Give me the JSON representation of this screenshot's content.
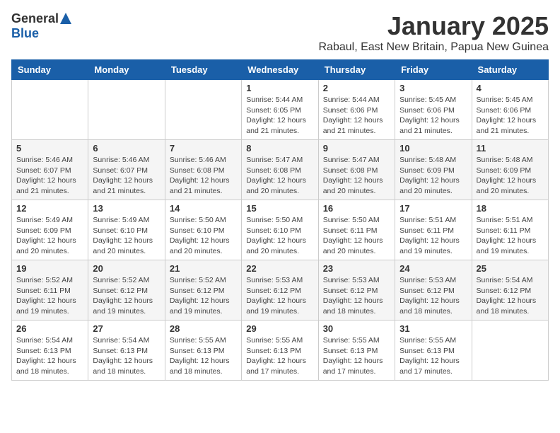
{
  "header": {
    "logo_general": "General",
    "logo_blue": "Blue",
    "month_title": "January 2025",
    "subtitle": "Rabaul, East New Britain, Papua New Guinea"
  },
  "calendar": {
    "weekdays": [
      "Sunday",
      "Monday",
      "Tuesday",
      "Wednesday",
      "Thursday",
      "Friday",
      "Saturday"
    ],
    "weeks": [
      [
        {
          "day": "",
          "info": ""
        },
        {
          "day": "",
          "info": ""
        },
        {
          "day": "",
          "info": ""
        },
        {
          "day": "1",
          "info": "Sunrise: 5:44 AM\nSunset: 6:05 PM\nDaylight: 12 hours\nand 21 minutes."
        },
        {
          "day": "2",
          "info": "Sunrise: 5:44 AM\nSunset: 6:06 PM\nDaylight: 12 hours\nand 21 minutes."
        },
        {
          "day": "3",
          "info": "Sunrise: 5:45 AM\nSunset: 6:06 PM\nDaylight: 12 hours\nand 21 minutes."
        },
        {
          "day": "4",
          "info": "Sunrise: 5:45 AM\nSunset: 6:06 PM\nDaylight: 12 hours\nand 21 minutes."
        }
      ],
      [
        {
          "day": "5",
          "info": "Sunrise: 5:46 AM\nSunset: 6:07 PM\nDaylight: 12 hours\nand 21 minutes."
        },
        {
          "day": "6",
          "info": "Sunrise: 5:46 AM\nSunset: 6:07 PM\nDaylight: 12 hours\nand 21 minutes."
        },
        {
          "day": "7",
          "info": "Sunrise: 5:46 AM\nSunset: 6:08 PM\nDaylight: 12 hours\nand 21 minutes."
        },
        {
          "day": "8",
          "info": "Sunrise: 5:47 AM\nSunset: 6:08 PM\nDaylight: 12 hours\nand 20 minutes."
        },
        {
          "day": "9",
          "info": "Sunrise: 5:47 AM\nSunset: 6:08 PM\nDaylight: 12 hours\nand 20 minutes."
        },
        {
          "day": "10",
          "info": "Sunrise: 5:48 AM\nSunset: 6:09 PM\nDaylight: 12 hours\nand 20 minutes."
        },
        {
          "day": "11",
          "info": "Sunrise: 5:48 AM\nSunset: 6:09 PM\nDaylight: 12 hours\nand 20 minutes."
        }
      ],
      [
        {
          "day": "12",
          "info": "Sunrise: 5:49 AM\nSunset: 6:09 PM\nDaylight: 12 hours\nand 20 minutes."
        },
        {
          "day": "13",
          "info": "Sunrise: 5:49 AM\nSunset: 6:10 PM\nDaylight: 12 hours\nand 20 minutes."
        },
        {
          "day": "14",
          "info": "Sunrise: 5:50 AM\nSunset: 6:10 PM\nDaylight: 12 hours\nand 20 minutes."
        },
        {
          "day": "15",
          "info": "Sunrise: 5:50 AM\nSunset: 6:10 PM\nDaylight: 12 hours\nand 20 minutes."
        },
        {
          "day": "16",
          "info": "Sunrise: 5:50 AM\nSunset: 6:11 PM\nDaylight: 12 hours\nand 20 minutes."
        },
        {
          "day": "17",
          "info": "Sunrise: 5:51 AM\nSunset: 6:11 PM\nDaylight: 12 hours\nand 19 minutes."
        },
        {
          "day": "18",
          "info": "Sunrise: 5:51 AM\nSunset: 6:11 PM\nDaylight: 12 hours\nand 19 minutes."
        }
      ],
      [
        {
          "day": "19",
          "info": "Sunrise: 5:52 AM\nSunset: 6:11 PM\nDaylight: 12 hours\nand 19 minutes."
        },
        {
          "day": "20",
          "info": "Sunrise: 5:52 AM\nSunset: 6:12 PM\nDaylight: 12 hours\nand 19 minutes."
        },
        {
          "day": "21",
          "info": "Sunrise: 5:52 AM\nSunset: 6:12 PM\nDaylight: 12 hours\nand 19 minutes."
        },
        {
          "day": "22",
          "info": "Sunrise: 5:53 AM\nSunset: 6:12 PM\nDaylight: 12 hours\nand 19 minutes."
        },
        {
          "day": "23",
          "info": "Sunrise: 5:53 AM\nSunset: 6:12 PM\nDaylight: 12 hours\nand 18 minutes."
        },
        {
          "day": "24",
          "info": "Sunrise: 5:53 AM\nSunset: 6:12 PM\nDaylight: 12 hours\nand 18 minutes."
        },
        {
          "day": "25",
          "info": "Sunrise: 5:54 AM\nSunset: 6:12 PM\nDaylight: 12 hours\nand 18 minutes."
        }
      ],
      [
        {
          "day": "26",
          "info": "Sunrise: 5:54 AM\nSunset: 6:13 PM\nDaylight: 12 hours\nand 18 minutes."
        },
        {
          "day": "27",
          "info": "Sunrise: 5:54 AM\nSunset: 6:13 PM\nDaylight: 12 hours\nand 18 minutes."
        },
        {
          "day": "28",
          "info": "Sunrise: 5:55 AM\nSunset: 6:13 PM\nDaylight: 12 hours\nand 18 minutes."
        },
        {
          "day": "29",
          "info": "Sunrise: 5:55 AM\nSunset: 6:13 PM\nDaylight: 12 hours\nand 17 minutes."
        },
        {
          "day": "30",
          "info": "Sunrise: 5:55 AM\nSunset: 6:13 PM\nDaylight: 12 hours\nand 17 minutes."
        },
        {
          "day": "31",
          "info": "Sunrise: 5:55 AM\nSunset: 6:13 PM\nDaylight: 12 hours\nand 17 minutes."
        },
        {
          "day": "",
          "info": ""
        }
      ]
    ]
  }
}
